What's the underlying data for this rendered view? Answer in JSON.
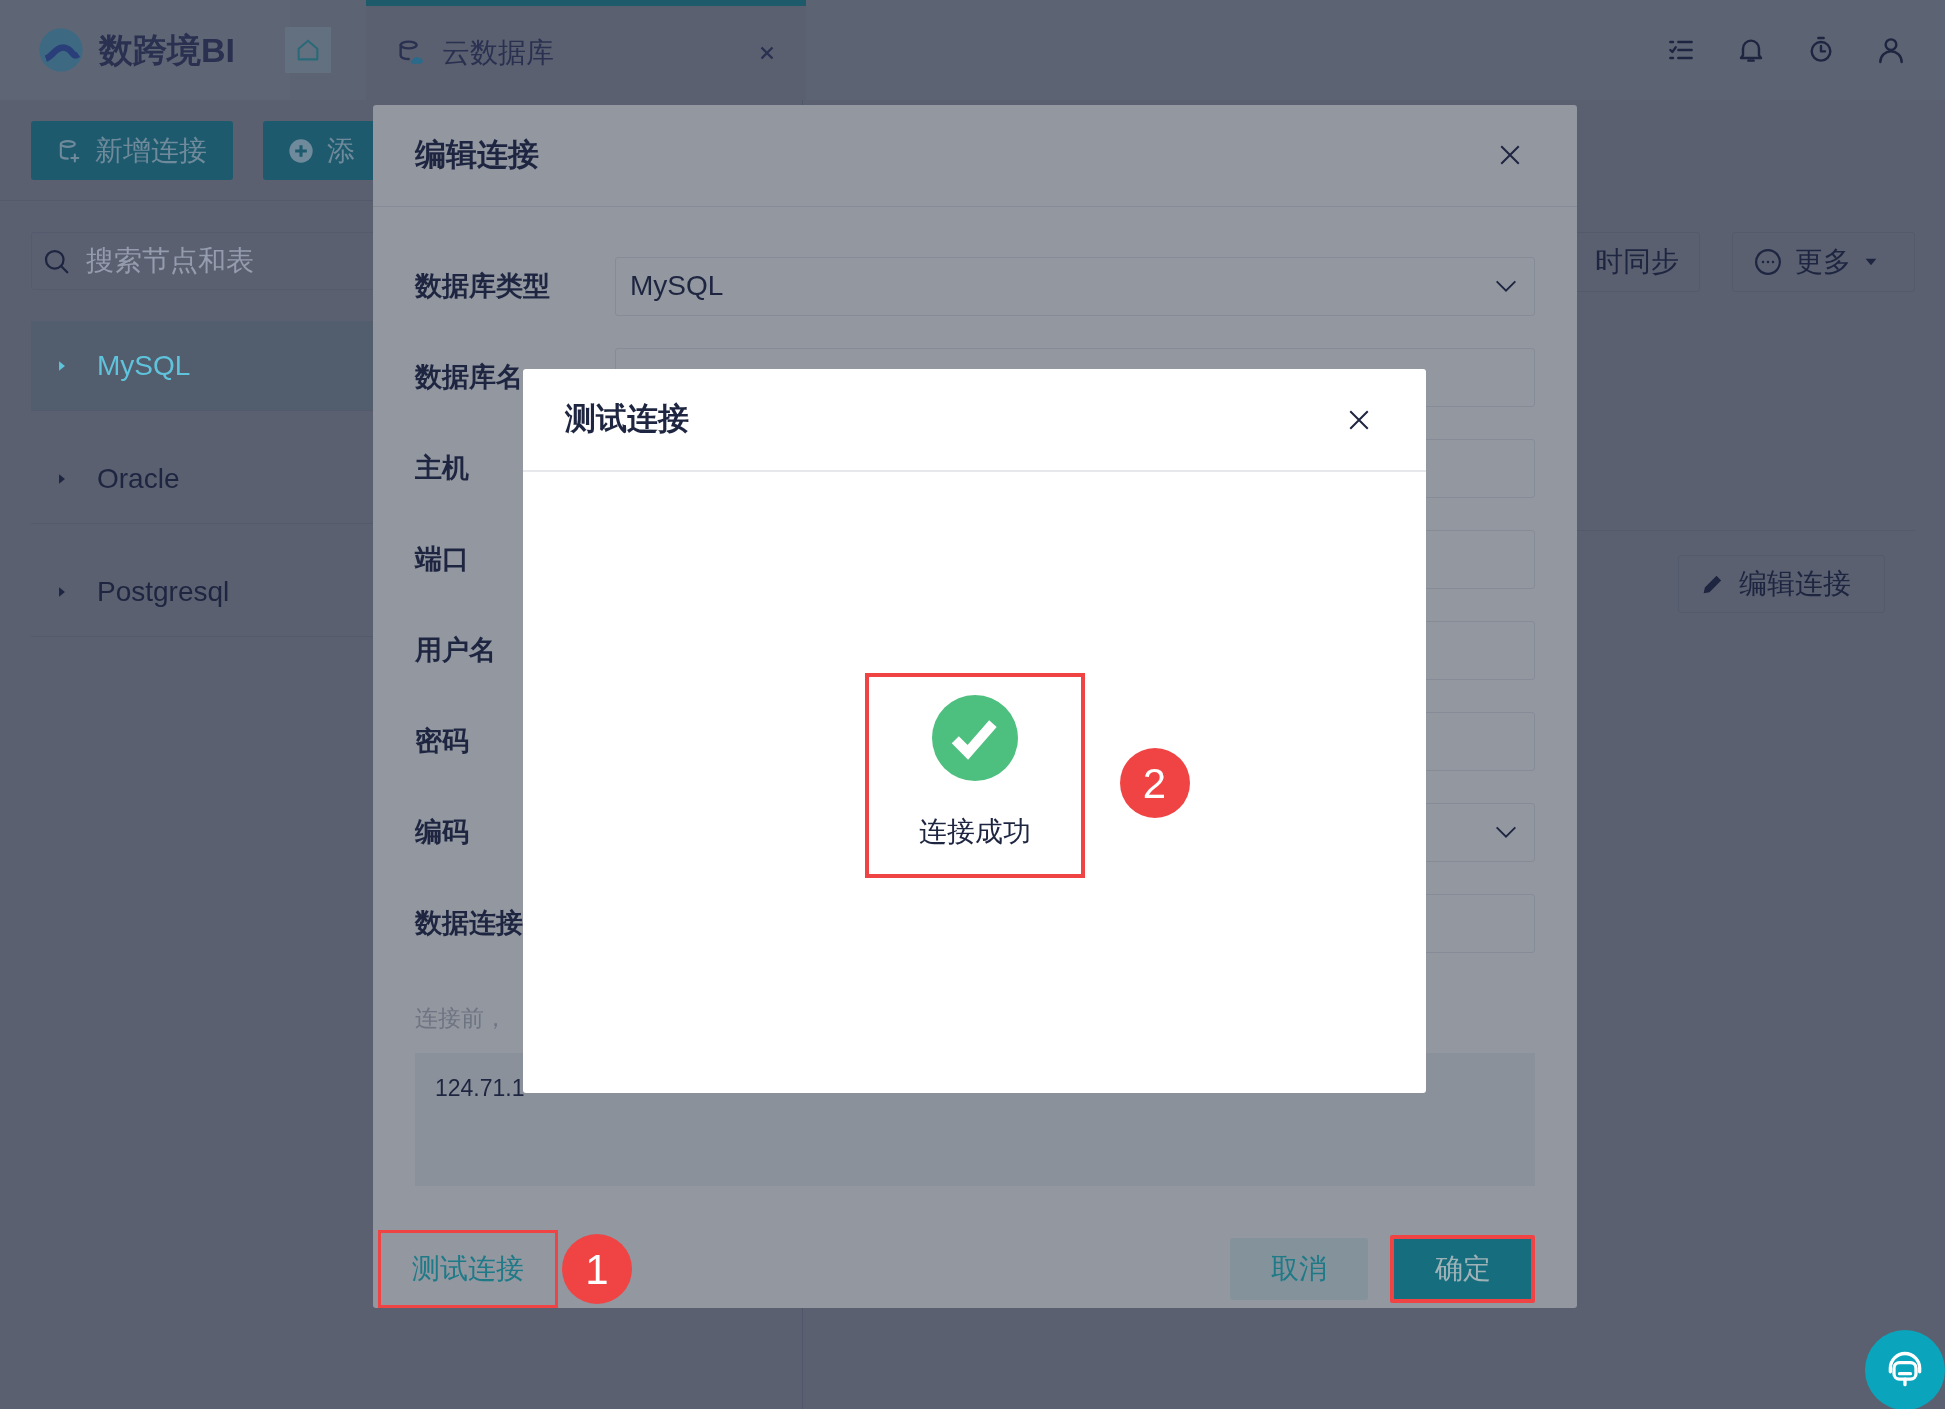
{
  "app": {
    "logo_text": "数跨境BI",
    "tabs": [
      {
        "label": "云数据库",
        "selected": true
      }
    ]
  },
  "toolbar": {
    "buttons": [
      {
        "label": "新增连接",
        "kind": "database"
      },
      {
        "label": "添",
        "kind": "add"
      }
    ]
  },
  "search": {
    "placeholder": "搜索节点和表"
  },
  "tree": [
    {
      "label": "MySQL",
      "selected": true
    },
    {
      "label": "Oracle",
      "selected": false
    },
    {
      "label": "Postgresql",
      "selected": false
    }
  ],
  "right_panel": {
    "sync_button": "时同步",
    "more_button": "更多",
    "edit_button": "编辑连接"
  },
  "edit_dialog": {
    "title": "编辑连接",
    "fields": [
      {
        "label": "数据库类型",
        "kind": "select",
        "value": "MySQL"
      },
      {
        "label": "数据库名",
        "kind": "input"
      },
      {
        "label": "主机",
        "kind": "input"
      },
      {
        "label": "端口",
        "kind": "input"
      },
      {
        "label": "用户名",
        "kind": "input"
      },
      {
        "label": "密码",
        "kind": "input"
      },
      {
        "label": "编码",
        "kind": "select"
      },
      {
        "label": "数据连接",
        "kind": "input"
      }
    ],
    "hint": "连接前，",
    "connection_text": "124.71.1",
    "test_link": {
      "label": "测试连接",
      "highlighted": true
    },
    "cancel": {
      "label": "取消",
      "highlighted": false
    },
    "confirm": {
      "label": "确定",
      "highlighted": true
    }
  },
  "test_dialog": {
    "title": "测试连接",
    "message": "连接成功",
    "success": true,
    "highlighted": true
  },
  "annotations": [
    {
      "label": "1"
    },
    {
      "label": "2"
    }
  ]
}
